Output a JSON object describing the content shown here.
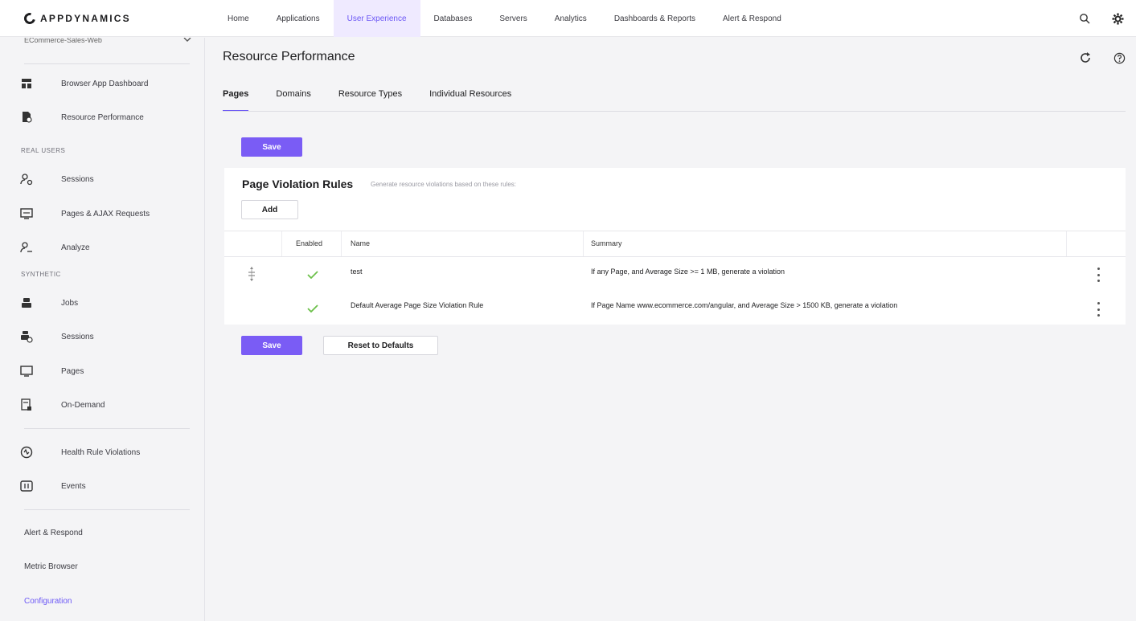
{
  "brand": {
    "name": "APPDYNAMICS"
  },
  "nav": {
    "items": [
      "Home",
      "Applications",
      "User Experience",
      "Databases",
      "Servers",
      "Analytics",
      "Dashboards & Reports",
      "Alert & Respond"
    ],
    "active": "User Experience"
  },
  "sidebar": {
    "app_name": "ECommerce-Sales-Web",
    "items_top": [
      {
        "label": "Browser App Dashboard",
        "icon": "dashboard-icon"
      },
      {
        "label": "Resource Performance",
        "icon": "resource-icon"
      }
    ],
    "section_real_users": "REAL USERS",
    "items_real": [
      {
        "label": "Sessions",
        "icon": "users-icon"
      },
      {
        "label": "Pages & AJAX Requests",
        "icon": "monitor-icon"
      },
      {
        "label": "Analyze",
        "icon": "analyze-icon"
      }
    ],
    "section_synthetic": "SYNTHETIC",
    "items_synthetic": [
      {
        "label": "Jobs",
        "icon": "robot-icon"
      },
      {
        "label": "Sessions",
        "icon": "robot-group-icon"
      },
      {
        "label": "Pages",
        "icon": "monitor-icon"
      },
      {
        "label": "On-Demand",
        "icon": "on-demand-icon"
      }
    ],
    "items_bottom": [
      {
        "label": "Health Rule Violations",
        "icon": "health-icon"
      },
      {
        "label": "Events",
        "icon": "events-icon"
      }
    ],
    "links": [
      "Alert & Respond",
      "Metric Browser",
      "Configuration"
    ],
    "active_link": "Configuration"
  },
  "page": {
    "title": "Resource Performance",
    "tabs": [
      "Pages",
      "Domains",
      "Resource Types",
      "Individual Resources"
    ],
    "active_tab": "Pages",
    "save_label": "Save",
    "reset_label": "Reset to Defaults"
  },
  "rules": {
    "title": "Page Violation Rules",
    "subtitle": "Generate resource violations based on these rules:",
    "add_label": "Add",
    "columns": [
      "Enabled",
      "Name",
      "Summary"
    ],
    "rows": [
      {
        "enabled": true,
        "name": "test",
        "summary": "If any Page, and Average Size >= 1 MB, generate a violation"
      },
      {
        "enabled": true,
        "name": "Default Average Page Size Violation Rule",
        "summary": "If Page Name www.ecommerce.com/angular, and Average Size > 1500 KB, generate a violation"
      }
    ]
  },
  "colors": {
    "accent": "#7a5cf5",
    "active_nav_bg": "#efeaff",
    "check": "#6cc04a"
  }
}
